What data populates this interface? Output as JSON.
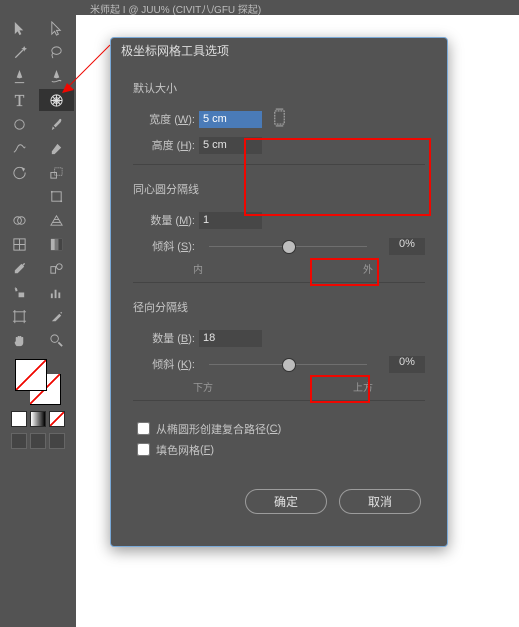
{
  "titlebar": "米师起 I  @ JUU% (CIVIT八/GFU 探起)",
  "dialog": {
    "title": "极坐标网格工具选项",
    "default_size": {
      "heading": "默认大小",
      "width_label": "宽度",
      "width_key": "W",
      "width_value": "5 cm",
      "height_label": "高度",
      "height_key": "H",
      "height_value": "5 cm"
    },
    "concentric": {
      "heading": "同心圆分隔线",
      "count_label": "数量",
      "count_key": "M",
      "count_value": "1",
      "skew_label": "倾斜",
      "skew_key": "S",
      "skew_value": "0%",
      "axis_left": "内",
      "axis_right": "外"
    },
    "radial": {
      "heading": "径向分隔线",
      "count_label": "数量",
      "count_key": "B",
      "count_value": "18",
      "skew_label": "倾斜",
      "skew_key": "K",
      "skew_value": "0%",
      "axis_left": "下方",
      "axis_right": "上方"
    },
    "compound_label": "从椭圆形创建复合路径",
    "compound_key": "C",
    "fill_label": "填色网格",
    "fill_key": "F",
    "ok": "确定",
    "cancel": "取消"
  }
}
